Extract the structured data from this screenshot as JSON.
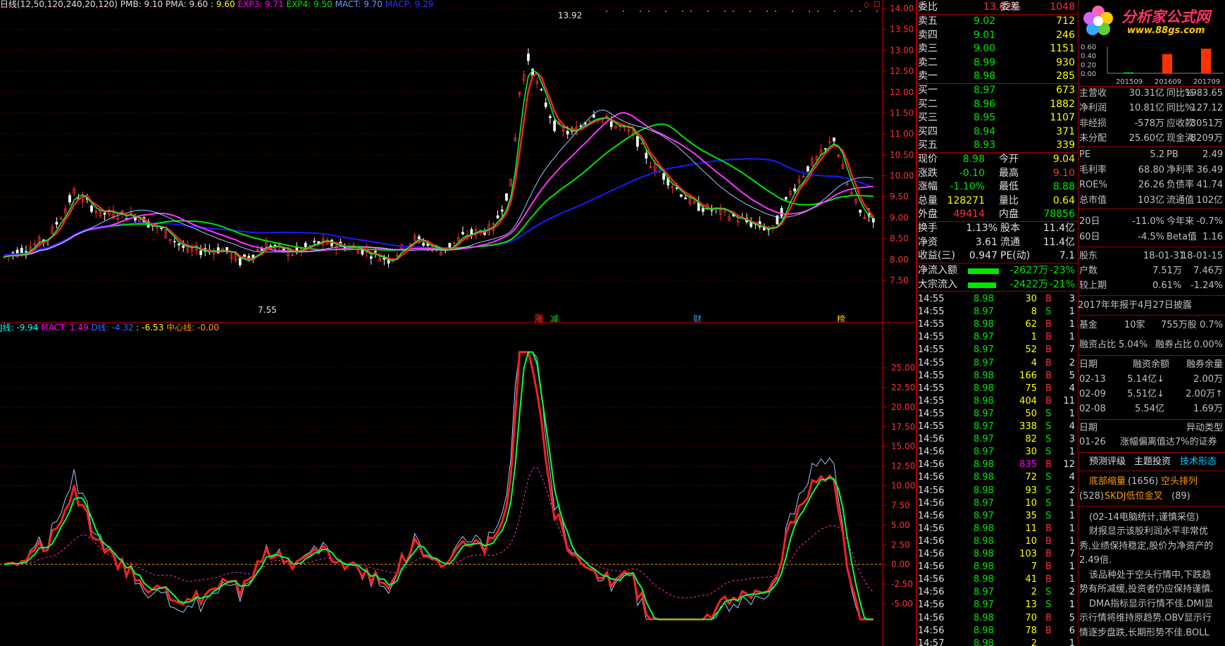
{
  "main_legend": {
    "title": "日线(12,50,120,240,20,120)",
    "pmb": "PMB: 9.10",
    "pma": "PMA: 9.60",
    "v1": ": 9.60",
    "exp3": "EXP3: 9.71",
    "exp4": "EXP4: 9.50",
    "mact": "MACT: 9.70",
    "macp": "MACP: 9.29"
  },
  "price_axis": [
    "14.00",
    "13.50",
    "13.00",
    "12.50",
    "12.00",
    "11.50",
    "11.00",
    "10.50",
    "10.00",
    "9.50",
    "9.00",
    "8.50",
    "8.00",
    "7.50"
  ],
  "annotations": {
    "high": "13.92",
    "low": "7.55"
  },
  "event_markers": [
    {
      "text": "涨",
      "color": "#ff3232"
    },
    {
      "text": "减",
      "color": "#00e600"
    },
    {
      "text": "财",
      "color": "#3399ff"
    },
    {
      "text": "榜",
      "color": "#ffcc00"
    }
  ],
  "sub_legend": {
    "j": "J线: -9.94",
    "mact": "MACT: 1.49",
    "d": "D线: -4.32",
    "k": ": -6.53",
    "center": "中心线: -0.00"
  },
  "sub_axis": [
    "25.00",
    "22.50",
    "20.00",
    "17.50",
    "15.00",
    "12.50",
    "10.00",
    "7.50",
    "5.00",
    "2.50",
    "0.00",
    "-2.50",
    "-5.00"
  ],
  "quote": {
    "weibi_label": "委比",
    "weibi_value": "13.62%",
    "weicha_label": "委差",
    "weicha_value": "1048",
    "sells": [
      {
        "label": "卖五",
        "price": "9.02",
        "vol": "712"
      },
      {
        "label": "卖四",
        "price": "9.01",
        "vol": "246"
      },
      {
        "label": "卖三",
        "price": "9.00",
        "vol": "1151"
      },
      {
        "label": "卖二",
        "price": "8.99",
        "vol": "930"
      },
      {
        "label": "卖一",
        "price": "8.98",
        "vol": "285"
      }
    ],
    "buys": [
      {
        "label": "买一",
        "price": "8.97",
        "vol": "673"
      },
      {
        "label": "买二",
        "price": "8.96",
        "vol": "1882"
      },
      {
        "label": "买三",
        "price": "8.95",
        "vol": "1107"
      },
      {
        "label": "买四",
        "price": "8.94",
        "vol": "371"
      },
      {
        "label": "买五",
        "price": "8.93",
        "vol": "339"
      }
    ],
    "stats": [
      {
        "l1": "现价",
        "v1": "8.98",
        "c1": "green",
        "l2": "今开",
        "v2": "9.04",
        "c2": "yellow"
      },
      {
        "l1": "涨跌",
        "v1": "-0.10",
        "c1": "green",
        "l2": "最高",
        "v2": "9.10",
        "c2": "red"
      },
      {
        "l1": "涨幅",
        "v1": "-1.10%",
        "c1": "green",
        "l2": "最低",
        "v2": "8.88",
        "c2": "green"
      },
      {
        "l1": "总量",
        "v1": "128271",
        "c1": "yellow",
        "l2": "量比",
        "v2": "0.64",
        "c2": "yellow"
      },
      {
        "l1": "外盘",
        "v1": "49414",
        "c1": "red",
        "l2": "内盘",
        "v2": "78856",
        "c2": "green"
      }
    ],
    "stats2": [
      {
        "l1": "换手",
        "v1": "1.13%",
        "l2": "股本",
        "v2": "11.4亿"
      },
      {
        "l1": "净资",
        "v1": "3.61",
        "l2": "流通",
        "v2": "11.4亿"
      },
      {
        "l1": "收益(三)",
        "v1": "0.947",
        "l2": "PE(动)",
        "v2": "7.1"
      }
    ],
    "flows": [
      {
        "label": "净流入额",
        "value": "-2627万",
        "pct": "-23%",
        "bar": 0.23
      },
      {
        "label": "大宗流入",
        "value": "-2422万",
        "pct": "-21%",
        "bar": 0.21
      }
    ]
  },
  "ticks": [
    {
      "t": "14:55",
      "p": "8.98",
      "v": "30",
      "s": "B",
      "n": "3"
    },
    {
      "t": "14:55",
      "p": "8.97",
      "v": "8",
      "s": "S",
      "n": "1"
    },
    {
      "t": "14:55",
      "p": "8.98",
      "v": "62",
      "s": "B",
      "n": "1"
    },
    {
      "t": "14:55",
      "p": "8.97",
      "v": "1",
      "s": "B",
      "n": "1"
    },
    {
      "t": "14:55",
      "p": "8.97",
      "v": "52",
      "s": "B",
      "n": "7"
    },
    {
      "t": "14:55",
      "p": "8.97",
      "v": "4",
      "s": "B",
      "n": "2"
    },
    {
      "t": "14:55",
      "p": "8.98",
      "v": "166",
      "s": "B",
      "n": "5"
    },
    {
      "t": "14:55",
      "p": "8.98",
      "v": "75",
      "s": "B",
      "n": "4"
    },
    {
      "t": "14:55",
      "p": "8.98",
      "v": "404",
      "s": "B",
      "n": "11"
    },
    {
      "t": "14:55",
      "p": "8.97",
      "v": "50",
      "s": "S",
      "n": "1"
    },
    {
      "t": "14:55",
      "p": "8.97",
      "v": "338",
      "s": "S",
      "n": "4"
    },
    {
      "t": "14:56",
      "p": "8.97",
      "v": "82",
      "s": "S",
      "n": "3"
    },
    {
      "t": "14:56",
      "p": "8.97",
      "v": "30",
      "s": "S",
      "n": "1"
    },
    {
      "t": "14:56",
      "p": "8.98",
      "v": "835",
      "s": "B",
      "n": "12"
    },
    {
      "t": "14:56",
      "p": "8.98",
      "v": "72",
      "s": "S",
      "n": "4"
    },
    {
      "t": "14:56",
      "p": "8.98",
      "v": "93",
      "s": "S",
      "n": "2"
    },
    {
      "t": "14:56",
      "p": "8.97",
      "v": "10",
      "s": "S",
      "n": "1"
    },
    {
      "t": "14:56",
      "p": "8.97",
      "v": "35",
      "s": "S",
      "n": "1"
    },
    {
      "t": "14:56",
      "p": "8.98",
      "v": "11",
      "s": "B",
      "n": "1"
    },
    {
      "t": "14:56",
      "p": "8.98",
      "v": "10",
      "s": "B",
      "n": "1"
    },
    {
      "t": "14:56",
      "p": "8.98",
      "v": "103",
      "s": "B",
      "n": "7"
    },
    {
      "t": "14:56",
      "p": "8.98",
      "v": "7",
      "s": "B",
      "n": "1"
    },
    {
      "t": "14:56",
      "p": "8.98",
      "v": "41",
      "s": "B",
      "n": "1"
    },
    {
      "t": "14:56",
      "p": "8.97",
      "v": "2",
      "s": "S",
      "n": "2"
    },
    {
      "t": "14:56",
      "p": "8.97",
      "v": "13",
      "s": "S",
      "n": "1"
    },
    {
      "t": "14:56",
      "p": "8.98",
      "v": "70",
      "s": "B",
      "n": "5"
    },
    {
      "t": "14:56",
      "p": "8.98",
      "v": "78",
      "s": "B",
      "n": "6"
    },
    {
      "t": "14:57",
      "p": "8.98",
      "v": "2",
      "s": "",
      "n": "1"
    }
  ],
  "finance": {
    "logo_text": "分析家公式网",
    "logo_url": "www.88gs.com",
    "bar_chart": {
      "yticks": [
        "0.60",
        "0.40",
        "0.20",
        "0.00"
      ],
      "categories": [
        "201509",
        "201609",
        "201709"
      ],
      "values": [
        0.02,
        0.43,
        0.55
      ]
    },
    "rows1": [
      {
        "l1": "主营收",
        "v1": "30.31亿",
        "l2": "同比%",
        "v2": "1983.65"
      },
      {
        "l1": "净利润",
        "v1": "10.81亿",
        "l2": "同比%",
        "v2": "127.12"
      },
      {
        "l1": "非经损",
        "v1": "-578万",
        "l2": "应收款",
        "v2": "3051万"
      },
      {
        "l1": "未分配",
        "v1": "25.60亿",
        "l2": "现金流",
        "v2": "-8209万"
      }
    ],
    "rows2": [
      {
        "l1": "PE",
        "v1": "5.2",
        "l2": "PB",
        "v2": "2.49"
      },
      {
        "l1": "毛利率",
        "v1": "68.80",
        "l2": "净利率",
        "v2": "36.49"
      },
      {
        "l1": "ROE%",
        "v1": "26.26",
        "l2": "负债率",
        "v2": "41.74"
      },
      {
        "l1": "总市值",
        "v1": "103亿",
        "l2": "流通值",
        "v2": "102亿"
      }
    ],
    "rows3": [
      {
        "l1": "20日",
        "v1": "-11.0%",
        "l2": "今年来",
        "v2": "-0.7%"
      },
      {
        "l1": "60日",
        "v1": "-4.5%",
        "l2": "Beta值",
        "v2": "1.16"
      }
    ],
    "holders": {
      "label": "股东",
      "d1": "18-01-31",
      "d2": "18-01-15",
      "r1l": "户数",
      "r1a": "7.51万",
      "r1b": "7.46万",
      "r2l": "较上期",
      "r2a": "0.61%",
      "r2b": "-1.24%"
    },
    "report_note": "2017年年报于4月27日披露",
    "fund": {
      "label": "基金",
      "count": "10家",
      "shares": "755万股",
      "pct": "0.7%"
    },
    "margin_ratio": {
      "l1": "融资占比",
      "v1": "5.04%",
      "l2": "融券占比",
      "v2": "0.00%"
    },
    "margin_head": [
      "日期",
      "融资余额",
      "融券余量"
    ],
    "margin_rows": [
      {
        "d": "02-13",
        "a": "5.14亿↓",
        "b": "2.00万"
      },
      {
        "d": "02-09",
        "a": "5.51亿↓",
        "b": "2.00万↑"
      },
      {
        "d": "02-08",
        "a": "5.54亿",
        "b": "1.69万"
      }
    ],
    "abnormal_head": [
      "日期",
      "异动类型"
    ],
    "abnormal_row": {
      "d": "01-26",
      "t": "涨幅偏离值达7%的证券"
    },
    "tabs": [
      "预测评级",
      "主题投资",
      "技术形态"
    ],
    "patterns_line1a": "底部缩量",
    "patterns_line1b": "(1656)",
    "patterns_line1c": "空头排列",
    "patterns_line2a": "(528)",
    "patterns_line2b": "SKDJ低位金叉",
    "patterns_line2c": "(89)",
    "comment_head": "(02-14电脑统计,谨慎采信)",
    "comment_lines": [
      "财报显示该股利润水平非常优",
      "秀,业绩保持稳定,股价为净资产的",
      "2.49倍.",
      "该品种处于空头行情中,下跌趋",
      "势有所减缓,投资者仍应保持谨慎.",
      "DMA指标显示行情不佳.DMI显",
      "示行情将维持原趋势.OBV显示行",
      "情逐步盘跌,长期形势不佳.BOLL"
    ]
  }
}
